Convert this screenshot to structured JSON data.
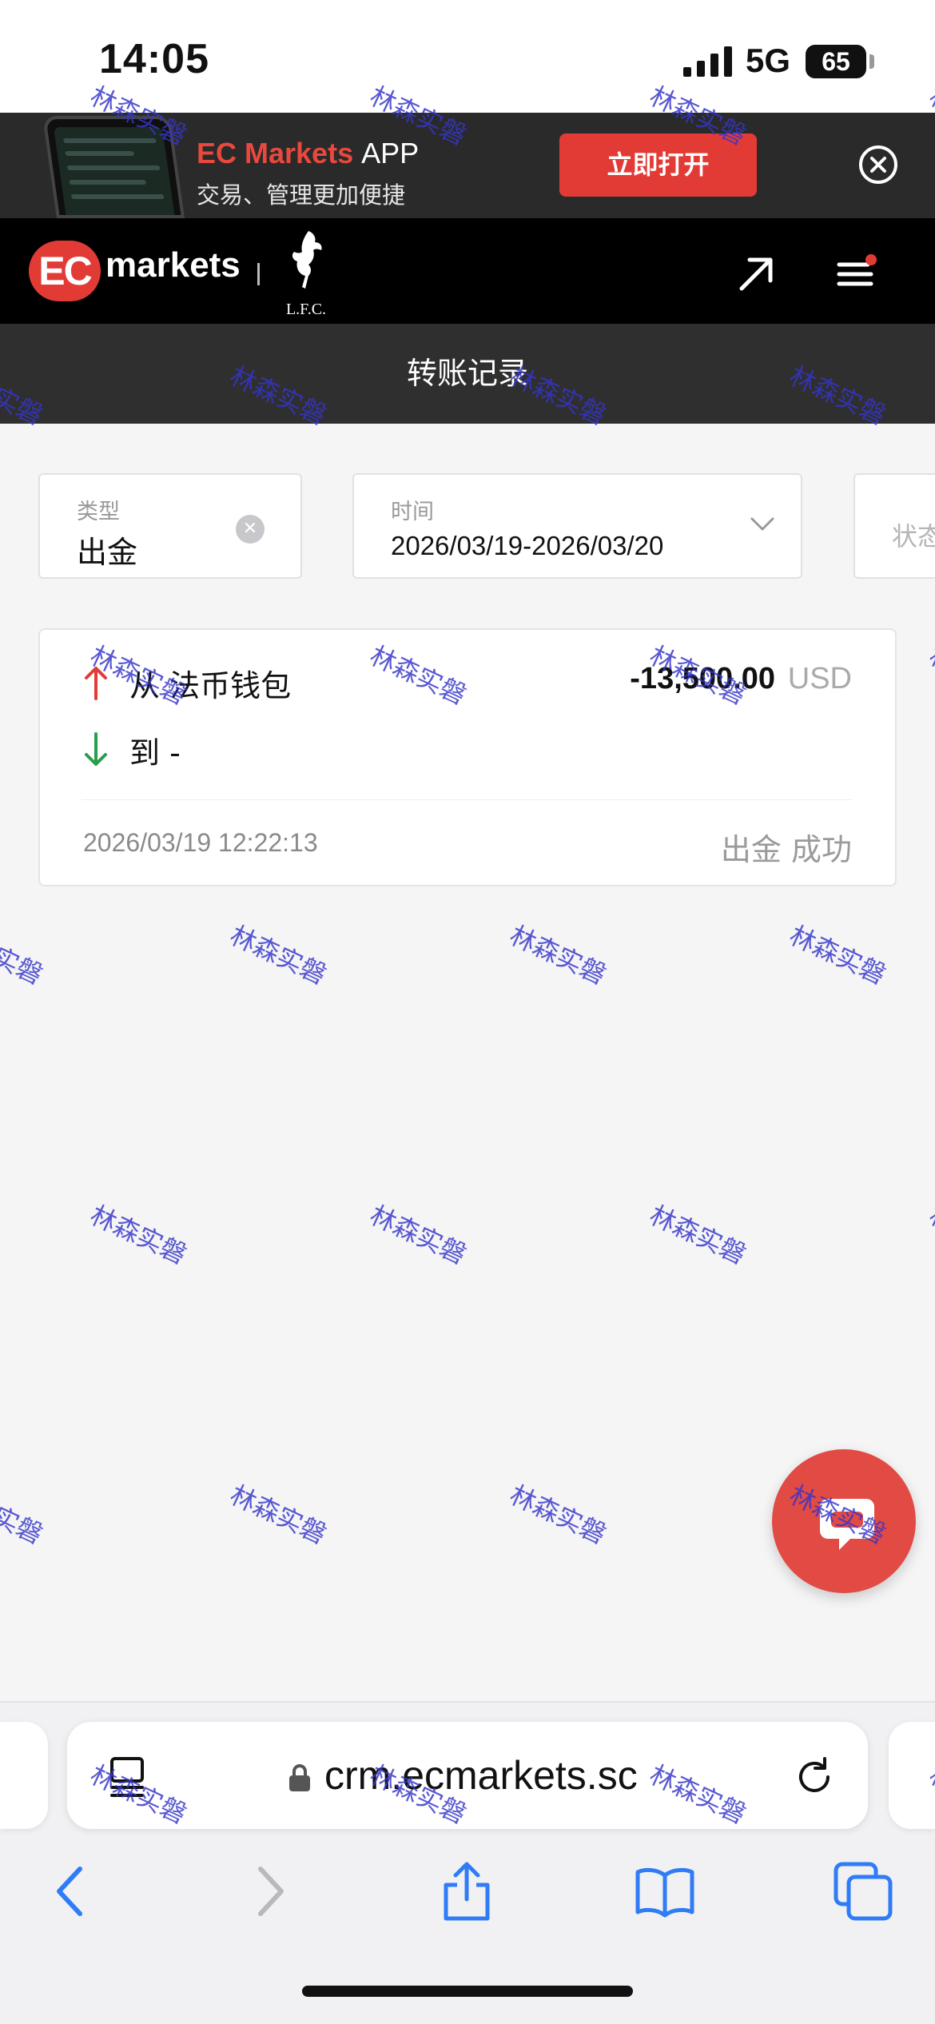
{
  "status_bar": {
    "time": "14:05",
    "network": "5G",
    "battery": "65"
  },
  "app_banner": {
    "brand": "EC Markets",
    "app_word": "APP",
    "subtitle": "交易、管理更加便捷",
    "open_button": "立即打开"
  },
  "navbar": {
    "logo_mark": "EC",
    "logo_text": "markets",
    "partner_text": "L.F.C."
  },
  "page": {
    "title": "转账记录"
  },
  "filters": {
    "type": {
      "label": "类型",
      "value": "出金"
    },
    "time": {
      "label": "时间",
      "value": "2026/03/19-2026/03/20"
    },
    "status": {
      "placeholder": "状态"
    }
  },
  "record": {
    "from_label": "从 法币钱包",
    "to_label": "到 -",
    "amount": "-13,500.00",
    "currency": "USD",
    "datetime": "2026/03/19 12:22:13",
    "status": "出金 成功",
    "colors": {
      "up_arrow": "#e23b35",
      "down_arrow": "#2a9d4b"
    }
  },
  "browser": {
    "url": "crm.ecmarkets.sc"
  },
  "watermark": {
    "text": "林森实磐"
  },
  "colors": {
    "brand_red": "#e23b35",
    "banner_bg": "#2a2a2a",
    "title_bg": "#2f2f2f",
    "watermark": "#3535c9"
  }
}
